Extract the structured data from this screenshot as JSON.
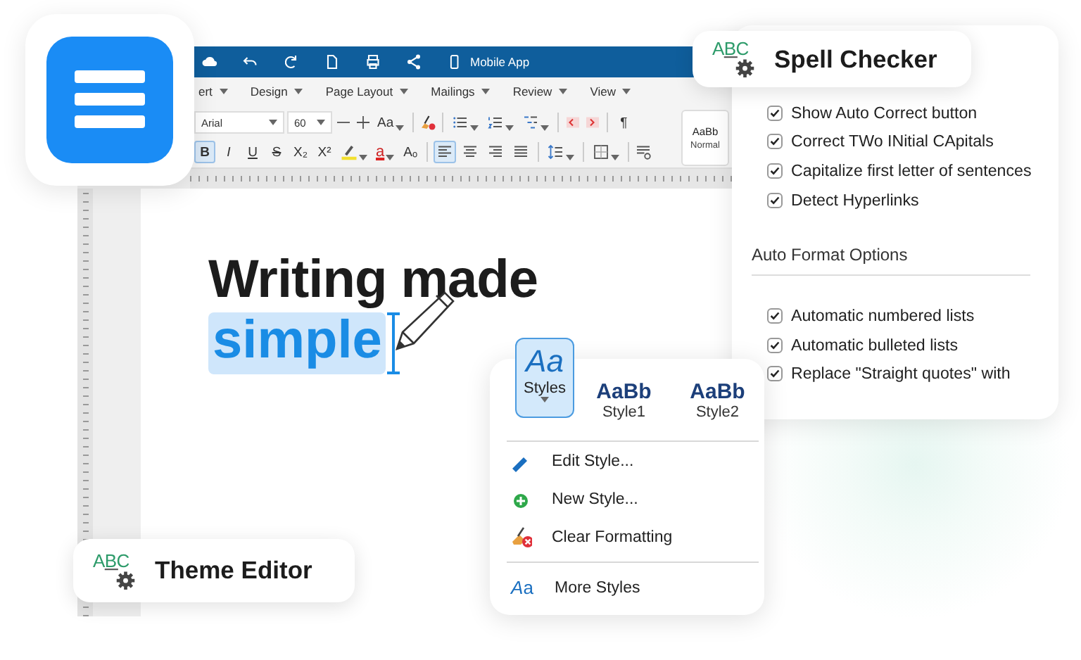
{
  "editor": {
    "title_bar": {
      "device_label": "Mobile App"
    },
    "tabs": [
      {
        "label": "ert"
      },
      {
        "label": "Design"
      },
      {
        "label": "Page Layout"
      },
      {
        "label": "Mailings"
      },
      {
        "label": "Review"
      },
      {
        "label": "View"
      }
    ],
    "font_field": {
      "value": "Arial"
    },
    "size_field": {
      "value": "60"
    },
    "change_case": "Aa",
    "paragraph_mark": "¶",
    "format_buttons": [
      {
        "label": "B",
        "kind": "bold",
        "selected": true
      },
      {
        "label": "I",
        "kind": "italic",
        "selected": false
      },
      {
        "label": "U",
        "kind": "underline",
        "selected": false
      },
      {
        "label": "S",
        "kind": "strike",
        "selected": false
      },
      {
        "label": "X₂",
        "kind": "plain",
        "selected": false
      },
      {
        "label": "X²",
        "kind": "plain",
        "selected": false
      }
    ],
    "font_color_letter": "a",
    "clear_format_label": "Aₒ",
    "align_buttons": [
      {
        "kind": "left",
        "selected": true
      },
      {
        "kind": "center",
        "selected": false
      },
      {
        "kind": "right",
        "selected": false
      },
      {
        "kind": "justify",
        "selected": false
      }
    ],
    "style_gallery": {
      "sample": "AaBb",
      "name": "Normal"
    },
    "document": {
      "heading": "Writing made",
      "selected_word": "simple"
    }
  },
  "spell_checker": {
    "badge": "ABC",
    "title": "Spell Checker",
    "options": [
      {
        "label": "Show Auto Correct button",
        "checked": true
      },
      {
        "label": "Correct TWo INitial CApitals",
        "checked": true
      },
      {
        "label": "Capitalize first letter of sentences",
        "checked": true
      },
      {
        "label": "Detect Hyperlinks",
        "checked": true
      }
    ],
    "section": "Auto Format Options",
    "format_options": [
      {
        "label": "Automatic numbered lists",
        "checked": true
      },
      {
        "label": "Automatic bulleted lists",
        "checked": true
      },
      {
        "label": "Replace \"Straight quotes\" with",
        "checked": true
      }
    ]
  },
  "styles_popup": {
    "styles_button": {
      "sample": "Aa",
      "label": "Styles",
      "selected": true
    },
    "styles": [
      {
        "sample": "AaBb",
        "name": "Style1"
      },
      {
        "sample": "AaBb",
        "name": "Style2"
      }
    ],
    "menu": [
      {
        "label": "Edit Style...",
        "kind": "edit"
      },
      {
        "label": "New Style...",
        "kind": "new"
      },
      {
        "label": "Clear Formatting",
        "kind": "clear"
      },
      {
        "label": "More Styles",
        "kind": "more",
        "icon_text": "Aa"
      }
    ]
  },
  "theme_editor": {
    "badge": "ABC",
    "title": "Theme Editor"
  }
}
